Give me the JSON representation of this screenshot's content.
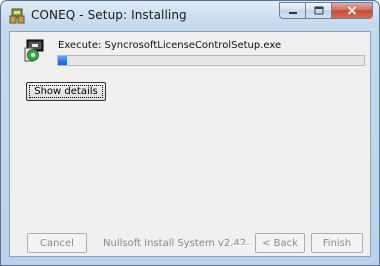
{
  "window": {
    "title": "CONEQ - Setup: Installing",
    "controls": {
      "minimize_icon": "minimize-icon",
      "maximize_icon": "maximize-icon",
      "close_icon": "close-icon"
    }
  },
  "install": {
    "icon": "installer-package-icon",
    "status_text": "Execute: SyncrosoftLicenseControlSetup.exe",
    "progress_fraction": 0.03
  },
  "buttons": {
    "show_details": "Show details",
    "cancel": "Cancel",
    "back": "< Back",
    "finish": "Finish"
  },
  "branding": {
    "text": "Nullsoft Install System v2.42"
  },
  "colors": {
    "progress_fill": "#2f7ef0",
    "close_button": "#c44b33"
  }
}
